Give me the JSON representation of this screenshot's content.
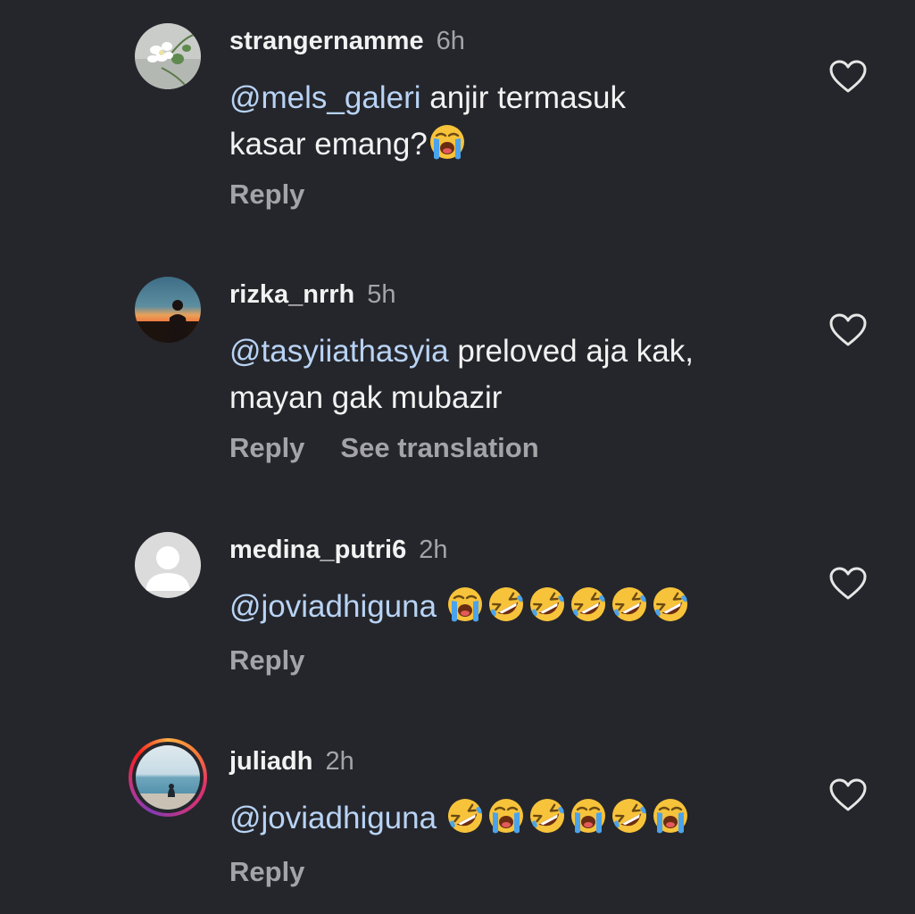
{
  "comments": [
    {
      "username": "strangernamme",
      "time": "6h",
      "mention": "@mels_galeri",
      "line1_rest": " anjir termasuk",
      "line2": "kasar emang?",
      "emoji_sequence": [
        "loudly-crying"
      ],
      "actions": {
        "reply": "Reply"
      }
    },
    {
      "username": "rizka_nrrh",
      "time": "5h",
      "mention": "@tasyiiathasyia",
      "line1_rest": " preloved aja kak,",
      "line2": "mayan gak mubazir",
      "actions": {
        "reply": "Reply",
        "see_translation": "See translation"
      }
    },
    {
      "username": "medina_putri6",
      "time": "2h",
      "mention": "@joviadhiguna",
      "emoji_sequence": [
        "loudly-crying",
        "rofl",
        "rofl",
        "rofl",
        "rofl",
        "rofl"
      ],
      "actions": {
        "reply": "Reply"
      }
    },
    {
      "username": "juliadh",
      "time": "2h",
      "mention": "@joviadhiguna",
      "emoji_sequence": [
        "rofl",
        "loudly-crying",
        "rofl",
        "loudly-crying",
        "rofl",
        "loudly-crying"
      ],
      "actions": {
        "reply": "Reply"
      }
    }
  ],
  "icons": {
    "like": "heart-outline-icon",
    "default_avatar": "default-user-icon"
  },
  "colors": {
    "background": "#25262b",
    "mention": "#b8d3f5",
    "secondary_text": "#a4a4a8",
    "primary_text": "#f2f2f2"
  }
}
